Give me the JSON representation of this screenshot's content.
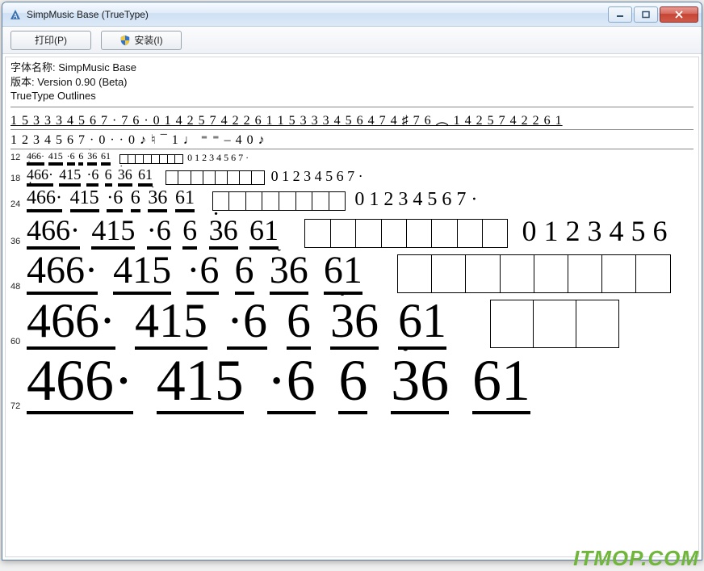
{
  "window": {
    "title": "SimpMusic Base (TrueType)"
  },
  "toolbar": {
    "print_label": "打印(P)",
    "install_label": "安装(I)"
  },
  "meta": {
    "font_name_label": "字体名称: SimpMusic Base",
    "version_label": "版本: Version 0.90 (Beta)",
    "outlines_label": "TrueType Outlines"
  },
  "preview": {
    "sample_line_1": "1 5 3 3 3 4 5 6  7  · 7 6  · 0 1 4 2 5 7 4 2 2 6 1  1 5 3 3 3 4 5 6 4 7 4 ♯ 7 6 ︵ 1 4 2 5 7 4 2 2 6 1",
    "sample_line_2": "1 2 3 4 5 6 7  · 0  ·  ·  0  ♪ ♮ ¯ 1 ♩ ⁼ ⁼ – 4 0 ♪",
    "sizes": [
      "12",
      "18",
      "24",
      "36",
      "48",
      "60",
      "72"
    ],
    "notation_groups": [
      "466·",
      "415",
      "·6",
      "6",
      "36",
      "61"
    ],
    "dot_above_index": 0,
    "dot_below_group": 0,
    "box_count": 8,
    "trailing_digits": "0 1 2 3 4 5 6 7  ·",
    "trailing_digits_36": "0 1 2 3 4 5 6"
  },
  "watermark": "ITMOP.COM"
}
